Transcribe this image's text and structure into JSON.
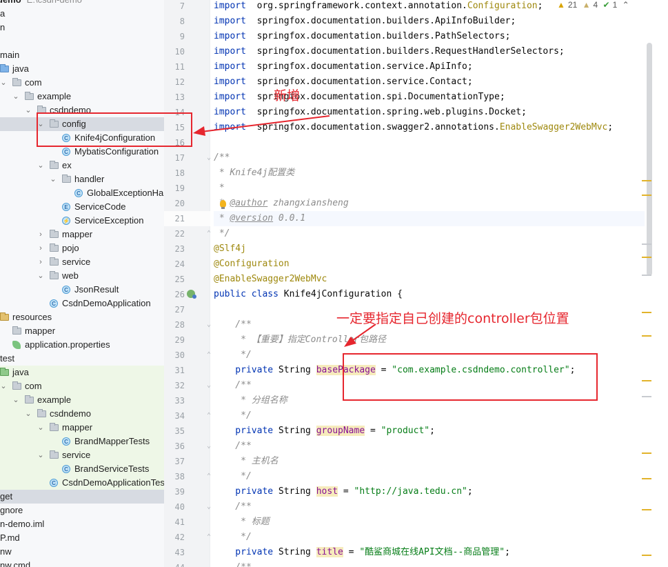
{
  "project_tree": {
    "header_project": "demo",
    "header_path": "E:\\csdn-demo",
    "rows": [
      {
        "label": "a",
        "icon": "none",
        "indent": 0,
        "arrow": "",
        "state": ""
      },
      {
        "label": "n",
        "icon": "none",
        "indent": 0,
        "arrow": "",
        "state": ""
      },
      {
        "label": "",
        "icon": "none",
        "indent": 0,
        "arrow": "",
        "state": ""
      },
      {
        "label": "main",
        "icon": "none",
        "indent": 0,
        "arrow": "",
        "state": ""
      },
      {
        "label": "java",
        "icon": "folder-src",
        "indent": 0,
        "arrow": "",
        "state": ""
      },
      {
        "label": "com",
        "icon": "folder",
        "indent": 1,
        "arrow": "open",
        "state": ""
      },
      {
        "label": "example",
        "icon": "folder",
        "indent": 2,
        "arrow": "open",
        "state": ""
      },
      {
        "label": "csdndemo",
        "icon": "folder",
        "indent": 3,
        "arrow": "open",
        "state": ""
      },
      {
        "label": "config",
        "icon": "folder",
        "indent": 4,
        "arrow": "open",
        "state": "selected"
      },
      {
        "label": "Knife4jConfiguration",
        "icon": "class",
        "indent": 5,
        "arrow": "",
        "state": ""
      },
      {
        "label": "MybatisConfiguration",
        "icon": "class",
        "indent": 5,
        "arrow": "",
        "state": ""
      },
      {
        "label": "ex",
        "icon": "folder",
        "indent": 4,
        "arrow": "open",
        "state": ""
      },
      {
        "label": "handler",
        "icon": "folder",
        "indent": 5,
        "arrow": "open",
        "state": ""
      },
      {
        "label": "GlobalExceptionHar",
        "icon": "class",
        "indent": 6,
        "arrow": "",
        "state": ""
      },
      {
        "label": "ServiceCode",
        "icon": "enum",
        "indent": 5,
        "arrow": "",
        "state": ""
      },
      {
        "label": "ServiceException",
        "icon": "exception",
        "indent": 5,
        "arrow": "",
        "state": ""
      },
      {
        "label": "mapper",
        "icon": "folder",
        "indent": 4,
        "arrow": "closed",
        "state": ""
      },
      {
        "label": "pojo",
        "icon": "folder",
        "indent": 4,
        "arrow": "closed",
        "state": ""
      },
      {
        "label": "service",
        "icon": "folder",
        "indent": 4,
        "arrow": "closed",
        "state": ""
      },
      {
        "label": "web",
        "icon": "folder",
        "indent": 4,
        "arrow": "open",
        "state": ""
      },
      {
        "label": "JsonResult",
        "icon": "class",
        "indent": 5,
        "arrow": "",
        "state": ""
      },
      {
        "label": "CsdnDemoApplication",
        "icon": "app",
        "indent": 4,
        "arrow": "",
        "state": ""
      },
      {
        "label": "resources",
        "icon": "folder-res",
        "indent": 0,
        "arrow": "",
        "state": ""
      },
      {
        "label": "mapper",
        "icon": "folder",
        "indent": 1,
        "arrow": "",
        "state": ""
      },
      {
        "label": "application.properties",
        "icon": "leaf",
        "indent": 1,
        "arrow": "",
        "state": ""
      },
      {
        "label": "test",
        "icon": "none",
        "indent": 0,
        "arrow": "",
        "state": ""
      },
      {
        "label": "java",
        "icon": "folder-test",
        "indent": 0,
        "arrow": "",
        "state": "test"
      },
      {
        "label": "com",
        "icon": "folder",
        "indent": 1,
        "arrow": "open",
        "state": "test"
      },
      {
        "label": "example",
        "icon": "folder",
        "indent": 2,
        "arrow": "open",
        "state": "test"
      },
      {
        "label": "csdndemo",
        "icon": "folder",
        "indent": 3,
        "arrow": "open",
        "state": "test"
      },
      {
        "label": "mapper",
        "icon": "folder",
        "indent": 4,
        "arrow": "open",
        "state": "test"
      },
      {
        "label": "BrandMapperTests",
        "icon": "app",
        "indent": 5,
        "arrow": "",
        "state": "test"
      },
      {
        "label": "service",
        "icon": "folder",
        "indent": 4,
        "arrow": "open",
        "state": "test"
      },
      {
        "label": "BrandServiceTests",
        "icon": "app",
        "indent": 5,
        "arrow": "",
        "state": "test"
      },
      {
        "label": "CsdnDemoApplicationTest",
        "icon": "app",
        "indent": 4,
        "arrow": "",
        "state": "test"
      },
      {
        "label": "get",
        "icon": "none",
        "indent": 0,
        "arrow": "",
        "state": "selected"
      },
      {
        "label": "gnore",
        "icon": "none",
        "indent": 0,
        "arrow": "",
        "state": ""
      },
      {
        "label": "n-demo.iml",
        "icon": "none",
        "indent": 0,
        "arrow": "",
        "state": ""
      },
      {
        "label": "P.md",
        "icon": "none",
        "indent": 0,
        "arrow": "",
        "state": ""
      },
      {
        "label": "nw",
        "icon": "none",
        "indent": 0,
        "arrow": "",
        "state": ""
      },
      {
        "label": "nw.cmd",
        "icon": "none",
        "indent": 0,
        "arrow": "",
        "state": ""
      }
    ]
  },
  "inspections": {
    "warnings": "21",
    "weak_warnings": "4",
    "ok": "1"
  },
  "editor": {
    "lines": [
      {
        "n": "7",
        "segs": [
          [
            "kw",
            "import"
          ],
          [
            "",
            "  org.springframework.context.annotation."
          ],
          [
            "ylw",
            "Configuration"
          ],
          [
            "",
            ";"
          ]
        ]
      },
      {
        "n": "8",
        "segs": [
          [
            "kw",
            "import"
          ],
          [
            "",
            "  springfox.documentation.builders.ApiInfoBuilder;"
          ]
        ]
      },
      {
        "n": "9",
        "segs": [
          [
            "kw",
            "import"
          ],
          [
            "",
            "  springfox.documentation.builders.PathSelectors;"
          ]
        ]
      },
      {
        "n": "10",
        "segs": [
          [
            "kw",
            "import"
          ],
          [
            "",
            "  springfox.documentation.builders.RequestHandlerSelectors;"
          ]
        ]
      },
      {
        "n": "11",
        "segs": [
          [
            "kw",
            "import"
          ],
          [
            "",
            "  springfox.documentation.service.ApiInfo;"
          ]
        ]
      },
      {
        "n": "12",
        "segs": [
          [
            "kw",
            "import"
          ],
          [
            "",
            "  springfox.documentation.service.Contact;"
          ]
        ]
      },
      {
        "n": "13",
        "segs": [
          [
            "kw",
            "import"
          ],
          [
            "",
            "  springfox.documentation.spi.DocumentationType;"
          ]
        ]
      },
      {
        "n": "14",
        "segs": [
          [
            "kw",
            "import"
          ],
          [
            "",
            "  springfox.documentation.spring.web.plugins.Docket;"
          ]
        ]
      },
      {
        "n": "15",
        "segs": [
          [
            "kw",
            "import"
          ],
          [
            "",
            "  springfox.documentation.swagger2.annotations."
          ],
          [
            "ylw",
            "EnableSwagger2WebMvc"
          ],
          [
            "",
            ";"
          ]
        ]
      },
      {
        "n": "16",
        "segs": []
      },
      {
        "n": "17",
        "segs": [
          [
            "cmt",
            "/**"
          ]
        ]
      },
      {
        "n": "18",
        "segs": [
          [
            "cmt",
            " * Knife4j配置类"
          ]
        ]
      },
      {
        "n": "19",
        "segs": [
          [
            "cmt",
            " *"
          ]
        ]
      },
      {
        "n": "20",
        "segs": [
          [
            "cmt",
            " * "
          ],
          [
            "tag",
            "@author"
          ],
          [
            "cmt",
            " zhangxiansheng"
          ]
        ]
      },
      {
        "n": "21",
        "segs": [
          [
            "cmt",
            " * "
          ],
          [
            "tag",
            "@version"
          ],
          [
            "cmt",
            " 0.0.1"
          ]
        ]
      },
      {
        "n": "22",
        "segs": [
          [
            "cmt",
            " */"
          ]
        ]
      },
      {
        "n": "23",
        "segs": [
          [
            "ann",
            "@Slf4j"
          ]
        ]
      },
      {
        "n": "24",
        "segs": [
          [
            "ann",
            "@Configuration"
          ]
        ]
      },
      {
        "n": "25",
        "segs": [
          [
            "ann",
            "@EnableSwagger2WebMvc"
          ]
        ]
      },
      {
        "n": "26",
        "segs": [
          [
            "kw",
            "public class"
          ],
          [
            "",
            " Knife4jConfiguration {"
          ]
        ]
      },
      {
        "n": "27",
        "segs": []
      },
      {
        "n": "28",
        "segs": [
          [
            "cmt",
            "    /**"
          ]
        ]
      },
      {
        "n": "29",
        "segs": [
          [
            "cmt",
            "     * 【重要】指定Controller包路径"
          ]
        ]
      },
      {
        "n": "30",
        "segs": [
          [
            "cmt",
            "     */"
          ]
        ]
      },
      {
        "n": "31",
        "segs": [
          [
            "kw",
            "    private"
          ],
          [
            "",
            " String "
          ],
          [
            "fldu",
            "basePackage"
          ],
          [
            "",
            " = "
          ],
          [
            "str",
            "\"com.example.csdndemo.controller\""
          ],
          [
            "",
            ";"
          ]
        ]
      },
      {
        "n": "32",
        "segs": [
          [
            "cmt",
            "    /**"
          ]
        ]
      },
      {
        "n": "33",
        "segs": [
          [
            "cmt",
            "     * 分组名称"
          ]
        ]
      },
      {
        "n": "34",
        "segs": [
          [
            "cmt",
            "     */"
          ]
        ]
      },
      {
        "n": "35",
        "segs": [
          [
            "kw",
            "    private"
          ],
          [
            "",
            " String "
          ],
          [
            "fldu",
            "groupName"
          ],
          [
            "",
            " = "
          ],
          [
            "str",
            "\"product\""
          ],
          [
            "",
            ";"
          ]
        ]
      },
      {
        "n": "36",
        "segs": [
          [
            "cmt",
            "    /**"
          ]
        ]
      },
      {
        "n": "37",
        "segs": [
          [
            "cmt",
            "     * 主机名"
          ]
        ]
      },
      {
        "n": "38",
        "segs": [
          [
            "cmt",
            "     */"
          ]
        ]
      },
      {
        "n": "39",
        "segs": [
          [
            "kw",
            "    private"
          ],
          [
            "",
            " String "
          ],
          [
            "fldu",
            "host"
          ],
          [
            "",
            " = "
          ],
          [
            "str",
            "\"http://java.tedu.cn\""
          ],
          [
            "",
            ";"
          ]
        ]
      },
      {
        "n": "40",
        "segs": [
          [
            "cmt",
            "    /**"
          ]
        ]
      },
      {
        "n": "41",
        "segs": [
          [
            "cmt",
            "     * 标题"
          ]
        ]
      },
      {
        "n": "42",
        "segs": [
          [
            "cmt",
            "     */"
          ]
        ]
      },
      {
        "n": "43",
        "segs": [
          [
            "kw",
            "    private"
          ],
          [
            "",
            " String "
          ],
          [
            "fldu",
            "title"
          ],
          [
            "",
            " = "
          ],
          [
            "str",
            "\"酷鲨商城在线API文档--商品管理\""
          ],
          [
            "",
            ";"
          ]
        ]
      },
      {
        "n": "44",
        "segs": [
          [
            "cmt",
            "    /**"
          ]
        ]
      }
    ]
  },
  "annotations": {
    "new_label": "新增",
    "controller_note": "一定要指定自己创建的controller包位置"
  },
  "colors": {
    "annotation_red": "#e6262e",
    "keyword": "#0033b3",
    "string": "#067d17",
    "comment": "#8c8c8c"
  }
}
